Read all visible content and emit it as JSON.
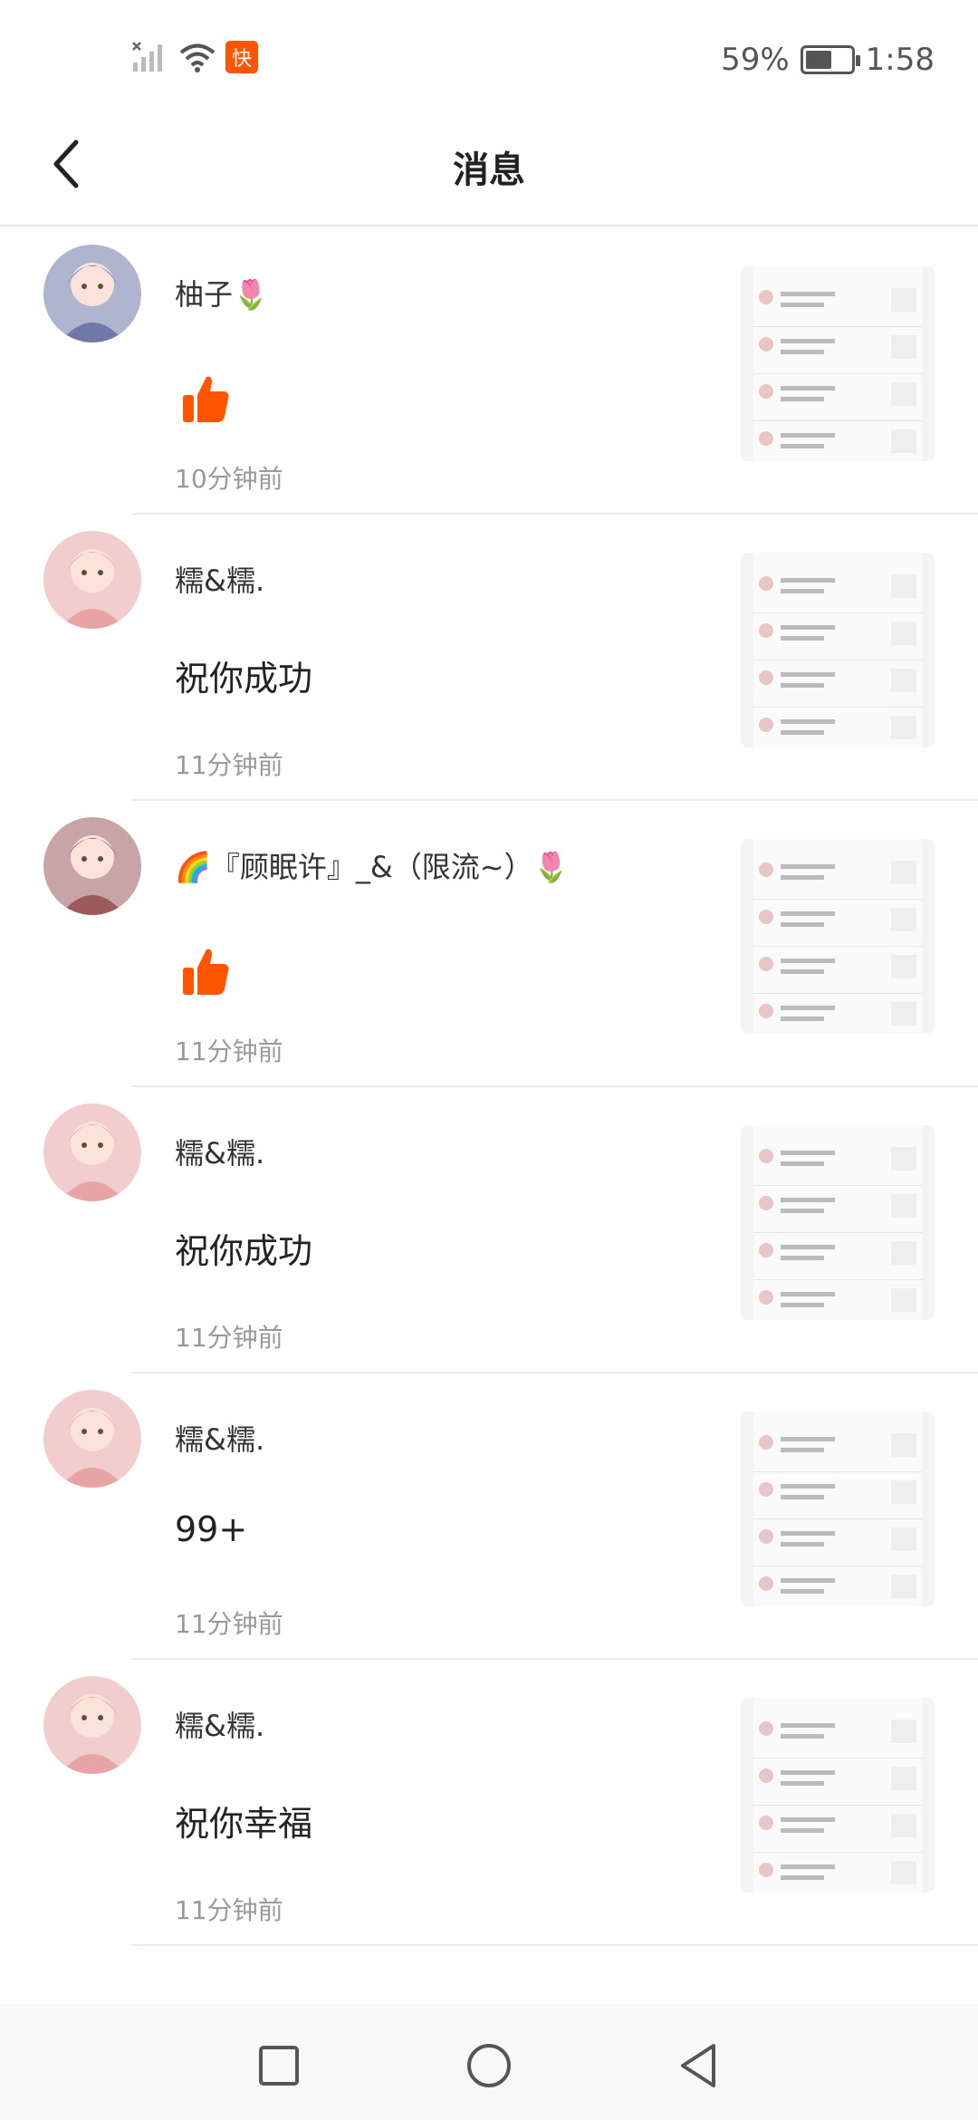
{
  "status_bar": {
    "app_badge": "快",
    "battery_text": "59%",
    "battery_level": 0.59,
    "time": "1:58"
  },
  "header": {
    "title": "消息"
  },
  "colors": {
    "accent": "#ff5500",
    "divider": "#ececec",
    "time_text": "#999999"
  },
  "messages": [
    {
      "name": "柚子🌷",
      "type": "like",
      "content": "",
      "time": "10分钟前",
      "avatar_color": "#6f78a8"
    },
    {
      "name": "糯&糯.",
      "type": "comment",
      "content": "祝你成功",
      "time": "11分钟前",
      "avatar_color": "#e8a4a4"
    },
    {
      "name": "🌈『顾眠许』_&（限流~）🌷",
      "type": "like",
      "content": "",
      "time": "11分钟前",
      "avatar_color": "#9c5a5e"
    },
    {
      "name": "糯&糯.",
      "type": "comment",
      "content": "祝你成功",
      "time": "11分钟前",
      "avatar_color": "#e8a4a4"
    },
    {
      "name": "糯&糯.",
      "type": "comment",
      "content": "99+",
      "time": "11分钟前",
      "avatar_color": "#e8a4a4"
    },
    {
      "name": "糯&糯.",
      "type": "comment",
      "content": "祝你幸福",
      "time": "11分钟前",
      "avatar_color": "#e8a4a4"
    }
  ],
  "icons": {
    "back": "chevron-left-icon",
    "like": "thumbs-up-icon",
    "nav_recent": "square-icon",
    "nav_home": "circle-icon",
    "nav_back": "triangle-back-icon"
  }
}
